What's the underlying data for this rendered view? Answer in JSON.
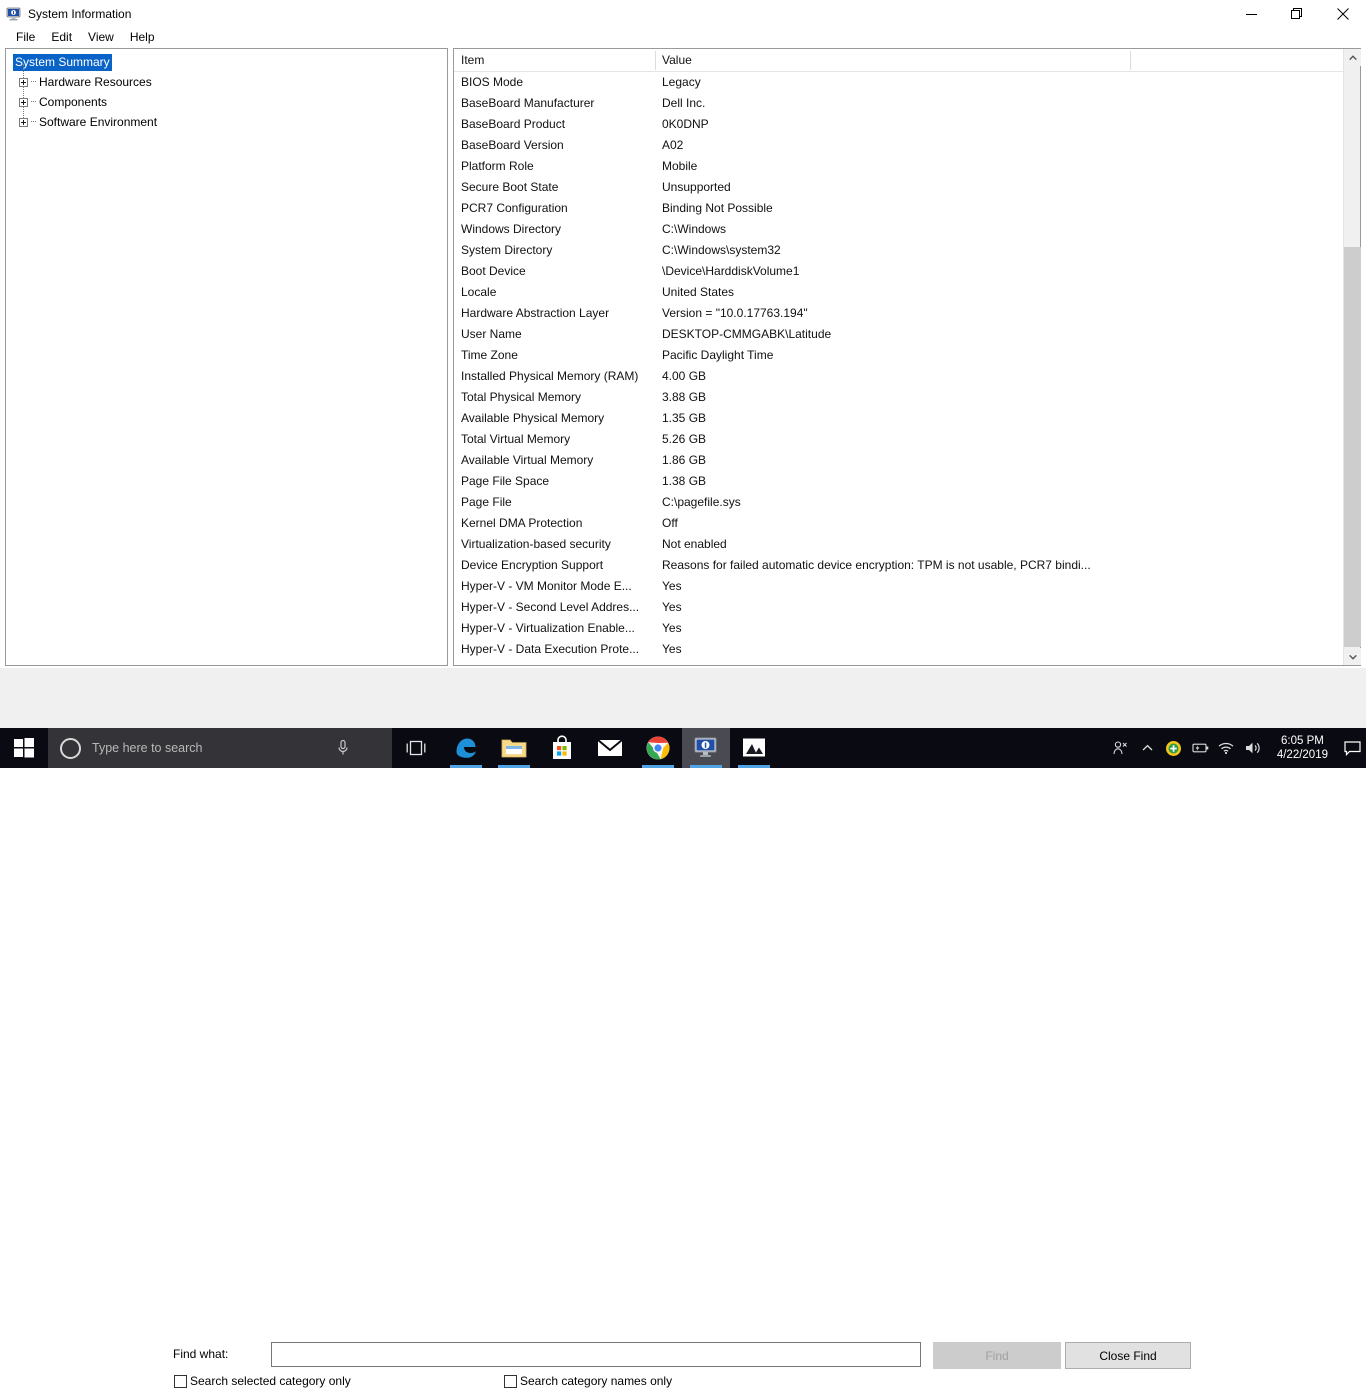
{
  "window": {
    "title": "System Information",
    "icon": "system-information-icon",
    "buttons": {
      "minimize": "—",
      "restore": "❐",
      "close": "✕"
    }
  },
  "menu": {
    "items": [
      "File",
      "Edit",
      "View",
      "Help"
    ]
  },
  "tree": {
    "selected": "System Summary",
    "nodes": [
      {
        "label": "System Summary",
        "expandable": false,
        "selected": true
      },
      {
        "label": "Hardware Resources",
        "expandable": true,
        "selected": false
      },
      {
        "label": "Components",
        "expandable": true,
        "selected": false
      },
      {
        "label": "Software Environment",
        "expandable": true,
        "selected": false
      }
    ]
  },
  "detail": {
    "columns": [
      "Item",
      "Value"
    ],
    "rows": [
      {
        "item": "BIOS Mode",
        "value": "Legacy"
      },
      {
        "item": "BaseBoard Manufacturer",
        "value": "Dell Inc."
      },
      {
        "item": "BaseBoard Product",
        "value": "0K0DNP"
      },
      {
        "item": "BaseBoard Version",
        "value": "A02"
      },
      {
        "item": "Platform Role",
        "value": "Mobile"
      },
      {
        "item": "Secure Boot State",
        "value": "Unsupported"
      },
      {
        "item": "PCR7 Configuration",
        "value": "Binding Not Possible"
      },
      {
        "item": "Windows Directory",
        "value": "C:\\Windows"
      },
      {
        "item": "System Directory",
        "value": "C:\\Windows\\system32"
      },
      {
        "item": "Boot Device",
        "value": "\\Device\\HarddiskVolume1"
      },
      {
        "item": "Locale",
        "value": "United States"
      },
      {
        "item": "Hardware Abstraction Layer",
        "value": "Version = \"10.0.17763.194\""
      },
      {
        "item": "User Name",
        "value": "DESKTOP-CMMGABK\\Latitude"
      },
      {
        "item": "Time Zone",
        "value": "Pacific Daylight Time"
      },
      {
        "item": "Installed Physical Memory (RAM)",
        "value": "4.00 GB"
      },
      {
        "item": "Total Physical Memory",
        "value": "3.88 GB"
      },
      {
        "item": "Available Physical Memory",
        "value": "1.35 GB"
      },
      {
        "item": "Total Virtual Memory",
        "value": "5.26 GB"
      },
      {
        "item": "Available Virtual Memory",
        "value": "1.86 GB"
      },
      {
        "item": "Page File Space",
        "value": "1.38 GB"
      },
      {
        "item": "Page File",
        "value": "C:\\pagefile.sys"
      },
      {
        "item": "Kernel DMA Protection",
        "value": "Off"
      },
      {
        "item": "Virtualization-based security",
        "value": "Not enabled"
      },
      {
        "item": "Device Encryption Support",
        "value": "Reasons for failed automatic device encryption: TPM is not usable, PCR7 bindi..."
      },
      {
        "item": "Hyper-V - VM Monitor Mode E...",
        "value": "Yes"
      },
      {
        "item": "Hyper-V - Second Level Addres...",
        "value": "Yes"
      },
      {
        "item": "Hyper-V - Virtualization Enable...",
        "value": "Yes"
      },
      {
        "item": "Hyper-V - Data Execution Prote...",
        "value": "Yes"
      }
    ]
  },
  "find": {
    "label": "Find what:",
    "input_value": "",
    "input_placeholder": "",
    "find_button": "Find",
    "find_button_disabled": true,
    "close_button": "Close Find",
    "checkbox_selected_category": "Search selected category only",
    "checkbox_selected_category_checked": false,
    "checkbox_category_names": "Search category names only",
    "checkbox_category_names_checked": false
  },
  "taskbar": {
    "start": "start-button",
    "search_placeholder": "Type here to search",
    "apps": [
      {
        "name": "edge",
        "active": false,
        "running": true
      },
      {
        "name": "file-explorer",
        "active": false,
        "running": true
      },
      {
        "name": "microsoft-store",
        "active": false,
        "running": false
      },
      {
        "name": "mail",
        "active": false,
        "running": false
      },
      {
        "name": "chrome",
        "active": false,
        "running": true
      },
      {
        "name": "system-information",
        "active": true,
        "running": true
      },
      {
        "name": "photos",
        "active": false,
        "running": true
      }
    ],
    "clock_time": "6:05 PM",
    "clock_date": "4/22/2019"
  },
  "colors": {
    "selection_blue": "#0a64c8",
    "taskbar": "#0a0a12",
    "taskbar_search": "#333338",
    "accent_underline": "#4fa3e3",
    "findbar_bg": "#f0f0f0"
  }
}
